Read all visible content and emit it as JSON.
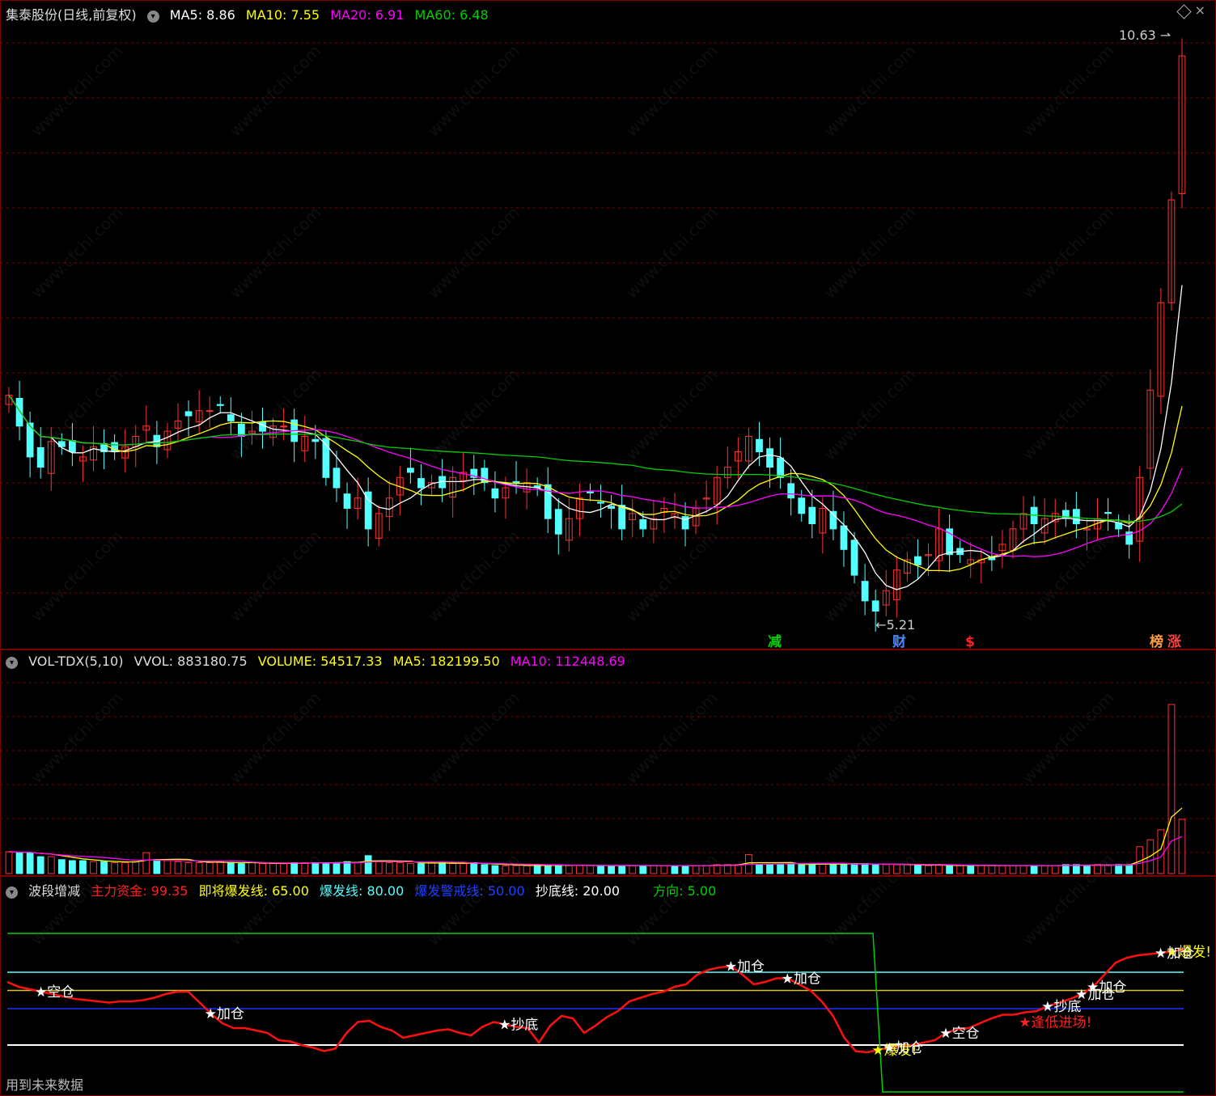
{
  "main": {
    "title": "集泰股份(日线,前复权)",
    "ma5": "MA5: 8.86",
    "ma10": "MA10: 7.55",
    "ma20": "MA20: 6.91",
    "ma60": "MA60: 6.48",
    "high_label": "10.63",
    "low_label": "←5.21",
    "markers": [
      "减",
      "财",
      "$",
      "榜",
      "涨"
    ]
  },
  "vol": {
    "title": "VOL-TDX(5,10)",
    "vvol": "VVOL: 883180.75",
    "volume": "VOLUME: 54517.33",
    "ma5": "MA5: 182199.50",
    "ma10": "MA10: 112448.69"
  },
  "indicator": {
    "title": "波段增减",
    "zhuli": "主力资金: 99.35",
    "jijiang": "即将爆发线: 65.00",
    "baofa": "爆发线: 80.00",
    "jingjie": "爆发警戒线: 50.00",
    "chaodi": "抄底线: 20.00",
    "fangxiang": "方向: 5.00",
    "footer": "用到未来数据",
    "signals": [
      "★空仓",
      "★加仓",
      "★抄底",
      "★加仓",
      "★加仓",
      "★爆发!",
      "★加仓",
      "★空仓",
      "★逢低进场!",
      "★抄底",
      "★加仓",
      "★加仓",
      "★爆发!",
      "★加仓"
    ]
  },
  "colors": {
    "up": "#ff3232",
    "down": "#54ffff",
    "ma5": "#ffffff",
    "ma10": "#ffff00",
    "ma20": "#ff00ff",
    "ma60": "#00d000",
    "grid": "#7a0000"
  },
  "chart_data": [
    {
      "type": "candlestick",
      "title": "集泰股份(日线,前复权)",
      "ylim": [
        5.0,
        10.9
      ],
      "annotations": {
        "high": 10.63,
        "low": 5.21
      },
      "close": [
        7.3,
        7.0,
        6.7,
        6.6,
        6.85,
        6.8,
        6.75,
        6.7,
        6.8,
        6.75,
        6.75,
        6.8,
        6.9,
        7.0,
        6.8,
        6.95,
        7.05,
        7.1,
        7.15,
        7.15,
        7.2,
        7.05,
        6.9,
        6.95,
        6.95,
        7.0,
        7.0,
        6.85,
        6.9,
        6.85,
        6.5,
        6.4,
        6.2,
        6.3,
        6.0,
        6.15,
        6.3,
        6.5,
        6.55,
        6.4,
        6.45,
        6.4,
        6.5,
        6.55,
        6.5,
        6.45,
        6.3,
        6.4,
        6.45,
        6.45,
        6.4,
        6.1,
        5.95,
        6.1,
        6.3,
        6.35,
        6.25,
        6.2,
        6.0,
        6.15,
        6.0,
        6.1,
        6.2,
        6.15,
        6.0,
        6.2,
        6.3,
        6.5,
        6.6,
        6.75,
        6.9,
        6.75,
        6.6,
        6.5,
        6.3,
        6.15,
        6.05,
        6.2,
        6.0,
        5.8,
        5.55,
        5.3,
        5.2,
        5.4,
        5.6,
        5.7,
        5.65,
        5.75,
        6.0,
        5.75,
        5.75,
        5.7,
        5.7,
        5.7,
        5.85,
        6.0,
        6.15,
        6.05,
        6.1,
        6.15,
        6.1,
        6.05,
        6.0,
        6.1,
        6.15,
        6.0,
        5.85,
        6.5,
        7.35,
        8.2,
        9.2,
        10.6
      ]
    },
    {
      "type": "bar",
      "title": "VOL-TDX(5,10)",
      "series": [
        {
          "name": "VOLUME",
          "values": [
            22000,
            21000,
            21000,
            17000,
            17000,
            14000,
            13000,
            13000,
            12000,
            12000,
            11000,
            11000,
            12000,
            21000,
            14000,
            13000,
            12000,
            11000,
            11000,
            11000,
            12000,
            11000,
            10000,
            11000,
            10000,
            10000,
            10000,
            11000,
            11000,
            11000,
            11000,
            11000,
            12000,
            11000,
            18000,
            12000,
            11000,
            11000,
            10000,
            10000,
            11000,
            11000,
            10000,
            10000,
            11000,
            9000,
            8000,
            8000,
            8000,
            8000,
            9000,
            8000,
            9000,
            8000,
            8000,
            8000,
            8000,
            8000,
            8000,
            8000,
            8000,
            8000,
            8000,
            8000,
            8000,
            8000,
            8000,
            9000,
            9000,
            9000,
            19000,
            9000,
            9000,
            9000,
            10000,
            9000,
            10000,
            10000,
            9000,
            10000,
            10000,
            10000,
            9000,
            9000,
            9000,
            9000,
            8000,
            8000,
            9000,
            8000,
            8000,
            8000,
            8000,
            8000,
            8000,
            8000,
            8000,
            8000,
            8000,
            8000,
            9000,
            9000,
            8000,
            9000,
            8000,
            9000,
            9000,
            27000,
            34000,
            44000,
            170000,
            54517
          ]
        }
      ]
    },
    {
      "type": "line",
      "title": "波段增减",
      "series": [
        {
          "name": "主力资金",
          "values": [
            72,
            68,
            66,
            64,
            62,
            60,
            58,
            57,
            56,
            55,
            56,
            56,
            57,
            59,
            62,
            64,
            64,
            55,
            46,
            38,
            34,
            34,
            32,
            30,
            24,
            23,
            20,
            18,
            15,
            17,
            30,
            39,
            40,
            35,
            32,
            26,
            28,
            30,
            32,
            33,
            30,
            28,
            35,
            39,
            37,
            35,
            34,
            22,
            36,
            44,
            42,
            30,
            36,
            43,
            48,
            56,
            59,
            62,
            64,
            68,
            70,
            78,
            82,
            84,
            85,
            78,
            70,
            72,
            75,
            75,
            70,
            65,
            56,
            44,
            26,
            15,
            14,
            16,
            18,
            19,
            20,
            22,
            24,
            30,
            33,
            34,
            38,
            42,
            45,
            45,
            47,
            48,
            52,
            55,
            58,
            62,
            68,
            78,
            88,
            92,
            94,
            95,
            96,
            97,
            99
          ]
        }
      ],
      "reference_lines": {
        "爆发线": 80,
        "即将爆发线": 65,
        "爆发警戒线": 50,
        "抄底线": 20
      }
    }
  ]
}
